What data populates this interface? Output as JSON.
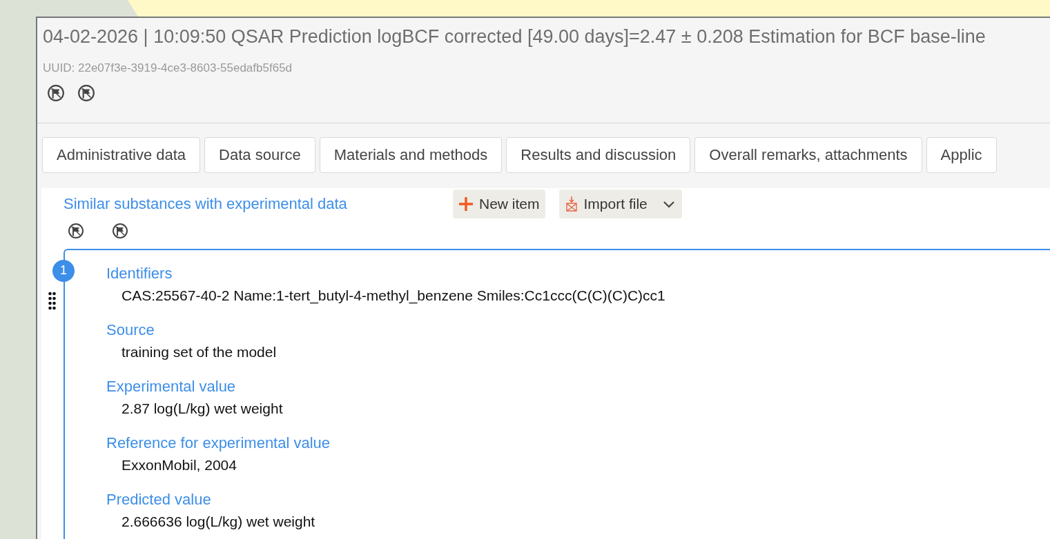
{
  "header": {
    "title": "04-02-2026 | 10:09:50 QSAR Prediction logBCF corrected [49.00 days]=2.47 ± 0.208 Estimation for BCF base-line",
    "uuid": "UUID: 22e07f3e-3919-4ce3-8603-55edafb5f65d"
  },
  "tabs": [
    {
      "label": "Administrative data",
      "selected": false
    },
    {
      "label": "Data source",
      "selected": false
    },
    {
      "label": "Materials and methods",
      "selected": false
    },
    {
      "label": "Results and discussion",
      "selected": false
    },
    {
      "label": "Overall remarks, attachments",
      "selected": false
    },
    {
      "label": "Applic",
      "selected": false
    }
  ],
  "section": {
    "title": "Similar substances with experimental data",
    "buttons": [
      {
        "kind": "add",
        "label": "New item"
      },
      {
        "kind": "import",
        "label": "Import file"
      }
    ],
    "items": [
      {
        "number": "1",
        "fields": [
          {
            "label": "Identifiers",
            "value": "CAS:25567-40-2 Name:1-tert_butyl-4-methyl_benzene Smiles:Cc1ccc(C(C)(C)C)cc1"
          },
          {
            "label": "Source",
            "value": "training set of the model"
          },
          {
            "label": "Experimental value",
            "value": "2.87  log(L/kg) wet weight"
          },
          {
            "label": "Reference for experimental value",
            "value": "ExxonMobil, 2004"
          },
          {
            "label": "Predicted value",
            "value": "2.666636  log(L/kg) wet weight"
          }
        ]
      }
    ]
  }
}
